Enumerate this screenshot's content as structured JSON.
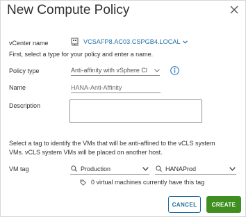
{
  "dialog": {
    "title": "New Compute Policy"
  },
  "vcenter": {
    "label": "vCenter name",
    "value": "VCSAFP8.AC03.CSPGB4.LOCAL"
  },
  "instruction": "First, select a type for your policy and enter a name.",
  "policy_type": {
    "label": "Policy type",
    "value": "Anti-affinity with vSphere Cl"
  },
  "name": {
    "label": "Name",
    "value": "HANA-Anti-Affinity"
  },
  "description": {
    "label": "Description",
    "value": ""
  },
  "tag_help": {
    "line1": "Select a tag to identify the VMs that will be anti-affined to the vCLS system",
    "line2": "VMs. vCLS system VMs will be placed on another host."
  },
  "vm_tag": {
    "label": "VM tag",
    "category": "Production",
    "tag": "HANAProd"
  },
  "vm_count_text": "0 virtual machines currently have this tag",
  "buttons": {
    "cancel": "CANCEL",
    "create": "CREATE"
  },
  "colors": {
    "link": "#1f6fa8",
    "primary": "#3e8f1f",
    "secondary_border": "#1e6d9e",
    "info_icon": "#2f7bbf"
  },
  "icons": {
    "close": "close-icon",
    "vcenter": "vcenter-icon",
    "info": "info-icon",
    "search": "search-icon",
    "tag": "tag-icon",
    "chevron": "chevron-down-icon"
  }
}
